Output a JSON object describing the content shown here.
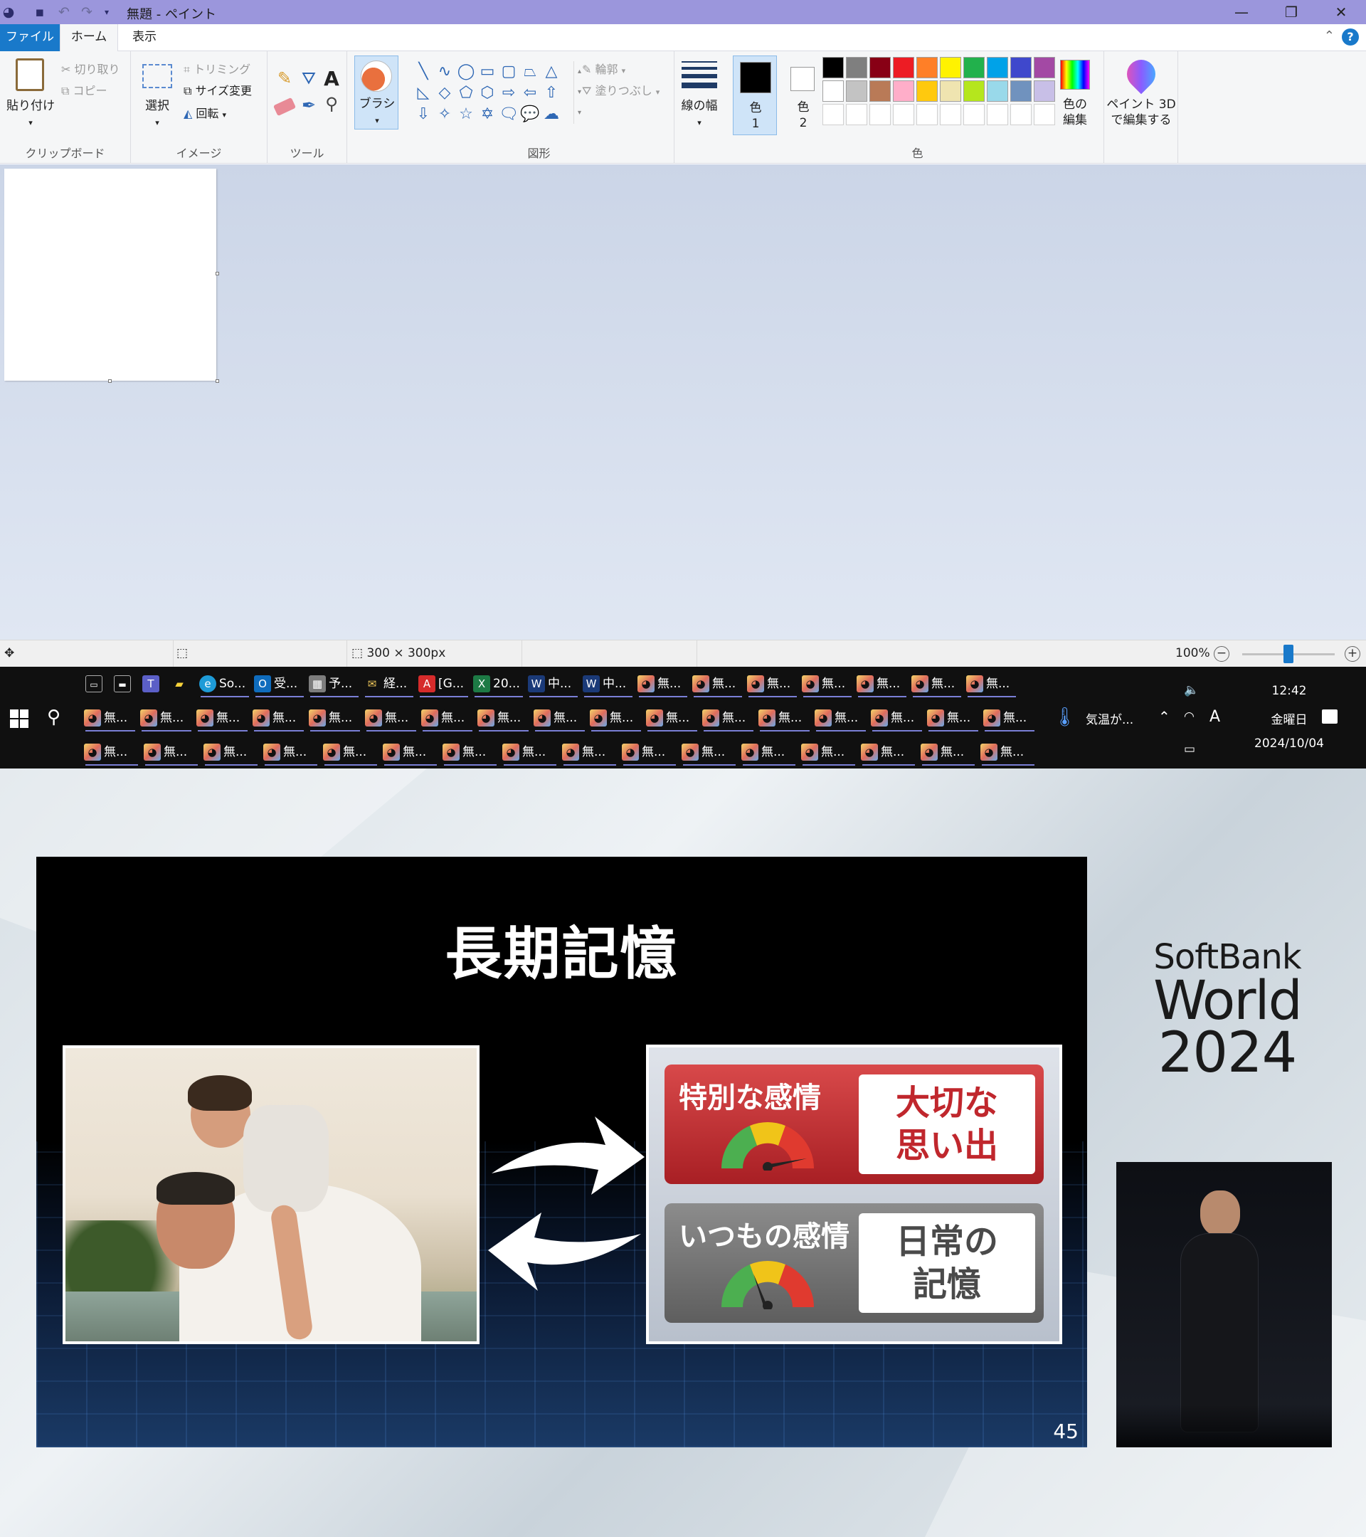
{
  "window": {
    "title": "無題 - ペイント",
    "controls": {
      "minimize": "—",
      "restore": "❐",
      "close": "✕"
    }
  },
  "tabs": {
    "file": "ファイル",
    "home": "ホーム",
    "view": "表示",
    "help": "?"
  },
  "ribbon": {
    "clipboard": {
      "paste": "貼り付け",
      "cut": "切り取り",
      "copy": "コピー",
      "group_label": "クリップボード"
    },
    "image": {
      "select": "選択",
      "crop": "トリミング",
      "resize": "サイズ変更",
      "rotate": "回転",
      "group_label": "イメージ"
    },
    "tools": {
      "group_label": "ツール",
      "text_tool": "A"
    },
    "brush": {
      "label": "ブラシ"
    },
    "shapes": {
      "outline": "輪郭",
      "fill": "塗りつぶし",
      "group_label": "図形"
    },
    "line_width": {
      "label": "線の幅"
    },
    "color1": {
      "label_top": "色",
      "label_num": "1",
      "value": "#000000"
    },
    "color2": {
      "label_top": "色",
      "label_num": "2",
      "value": "#ffffff"
    },
    "palette_row1": [
      "#000000",
      "#7f7f7f",
      "#880015",
      "#ed1c24",
      "#ff7f27",
      "#fff200",
      "#22b14c",
      "#00a2e8",
      "#3f48cc",
      "#a349a4"
    ],
    "palette_row2": [
      "#ffffff",
      "#c3c3c3",
      "#b97a57",
      "#ffaec9",
      "#ffc90e",
      "#efe4b0",
      "#b5e61d",
      "#99d9ea",
      "#7092be",
      "#c8bfe7"
    ],
    "edit_colors": {
      "line1": "色の",
      "line2": "編集"
    },
    "colors_group_label": "色",
    "paint3d": {
      "line1": "ペイント 3D",
      "line2": "で編集する"
    }
  },
  "statusbar": {
    "canvas_size": "300 × 300px",
    "zoom": "100%",
    "zoom_minus": "−",
    "zoom_plus": "+"
  },
  "taskbar": {
    "row1": [
      {
        "label": "",
        "icon": "terminal-icon",
        "glyph": "▭"
      },
      {
        "label": "",
        "icon": "window-icon",
        "glyph": "▬"
      },
      {
        "label": "",
        "icon": "teams-icon",
        "glyph": "T"
      },
      {
        "label": "",
        "icon": "sticky-notes-icon",
        "glyph": "▰"
      },
      {
        "label": "So...",
        "icon": "edge-icon",
        "glyph": "e"
      },
      {
        "label": "受...",
        "icon": "outlook-icon",
        "glyph": "O"
      },
      {
        "label": "予...",
        "icon": "calendar-icon",
        "glyph": "▦"
      },
      {
        "label": "経...",
        "icon": "mail-icon",
        "glyph": "✉"
      },
      {
        "label": "[G...",
        "icon": "pdf-icon",
        "glyph": "A"
      },
      {
        "label": "20...",
        "icon": "excel-icon",
        "glyph": "X"
      },
      {
        "label": "中...",
        "icon": "app-icon",
        "glyph": "W"
      },
      {
        "label": "中...",
        "icon": "app-icon",
        "glyph": "W"
      },
      {
        "label": "無...",
        "icon": "paint-icon",
        "glyph": "◕"
      },
      {
        "label": "無...",
        "icon": "paint-icon",
        "glyph": "◕"
      },
      {
        "label": "無...",
        "icon": "paint-icon",
        "glyph": "◕"
      },
      {
        "label": "無...",
        "icon": "paint-icon",
        "glyph": "◕"
      },
      {
        "label": "無...",
        "icon": "paint-icon",
        "glyph": "◕"
      },
      {
        "label": "無...",
        "icon": "paint-icon",
        "glyph": "◕"
      },
      {
        "label": "無...",
        "icon": "paint-icon",
        "glyph": "◕"
      }
    ],
    "row2_count_label": "無...",
    "row3_count_label": "無...",
    "weather": "気温が...",
    "time": "12:42",
    "day": "金曜日",
    "date": "2024/10/04",
    "ime": "A"
  },
  "slide": {
    "title": "長期記憶",
    "card1_title": "特別な感情",
    "card1_box_line1": "大切な",
    "card1_box_line2": "思い出",
    "card2_title": "いつもの感情",
    "card2_box_line1": "日常の",
    "card2_box_line2": "記憶",
    "page_number": "45"
  },
  "brand": {
    "line1": "SoftBank",
    "line2": "World",
    "line3": "2024"
  }
}
